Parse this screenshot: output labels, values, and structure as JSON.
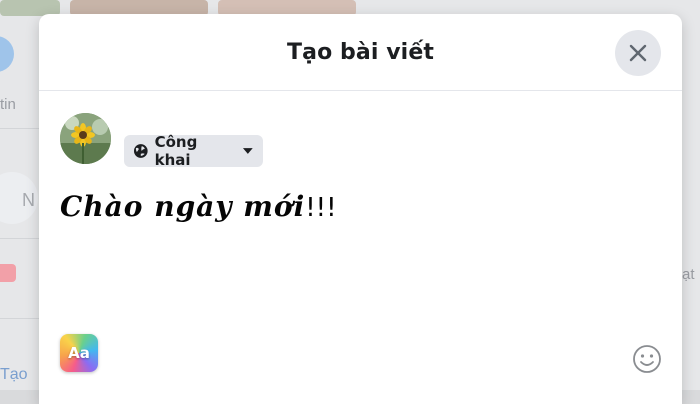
{
  "modal": {
    "title": "Tạo bài viết",
    "close_icon": "close-icon"
  },
  "composer": {
    "audience_label": "Công khai",
    "audience_icon": "globe-icon",
    "dropdown_icon": "caret-down-icon",
    "post_text_styled": "Chào ngày mới",
    "post_text_plain": "!!!",
    "background_picker_label": "Aa",
    "emoji_icon": "smiley-icon"
  },
  "background_page": {
    "left_text_1": "tin",
    "left_text_2": "Tạo",
    "right_text": "ạt"
  },
  "colors": {
    "modal_bg": "#ffffff",
    "button_gray": "#e4e6eb",
    "text_dark": "#1c1e21"
  }
}
